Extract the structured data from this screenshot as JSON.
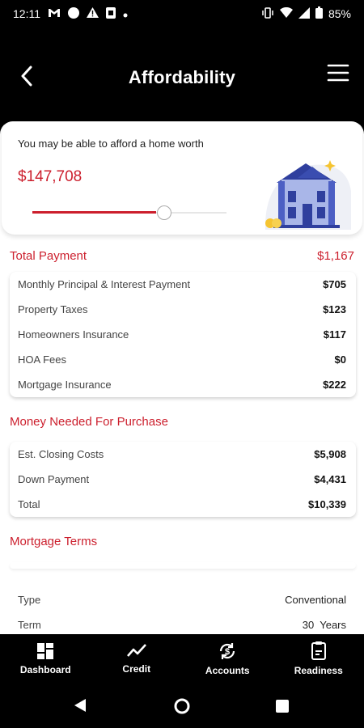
{
  "status_bar": {
    "time": "12:11",
    "battery": "85%"
  },
  "header": {
    "title": "Affordability"
  },
  "affordability": {
    "label": "You may be able to afford a home worth",
    "amount": "$147,708",
    "slider_fraction": 0.68
  },
  "total_payment": {
    "title": "Total Payment",
    "total": "$1,167",
    "rows": [
      {
        "label": "Monthly Principal & Interest Payment",
        "value": "$705"
      },
      {
        "label": "Property Taxes",
        "value": "$123"
      },
      {
        "label": "Homeowners Insurance",
        "value": "$117"
      },
      {
        "label": "HOA Fees",
        "value": "$0"
      },
      {
        "label": "Mortgage Insurance",
        "value": "$222"
      }
    ]
  },
  "money_needed": {
    "title": "Money Needed For Purchase",
    "rows": [
      {
        "label": "Est. Closing Costs",
        "value": "$5,908"
      },
      {
        "label": "Down Payment",
        "value": "$4,431"
      },
      {
        "label": "Total",
        "value": "$10,339"
      }
    ]
  },
  "mortgage_terms": {
    "title": "Mortgage Terms",
    "rows": [
      {
        "label": "Type",
        "value": "Conventional"
      },
      {
        "label": "Term",
        "value": "30  Years"
      }
    ]
  },
  "bottom_nav": {
    "items": [
      {
        "label": "Dashboard",
        "icon": "dashboard-icon"
      },
      {
        "label": "Credit",
        "icon": "credit-chart-icon"
      },
      {
        "label": "Accounts",
        "icon": "accounts-sync-icon"
      },
      {
        "label": "Readiness",
        "icon": "readiness-doc-icon"
      }
    ]
  },
  "colors": {
    "accent": "#cc1f2d",
    "background": "#000000",
    "surface": "#ffffff"
  }
}
